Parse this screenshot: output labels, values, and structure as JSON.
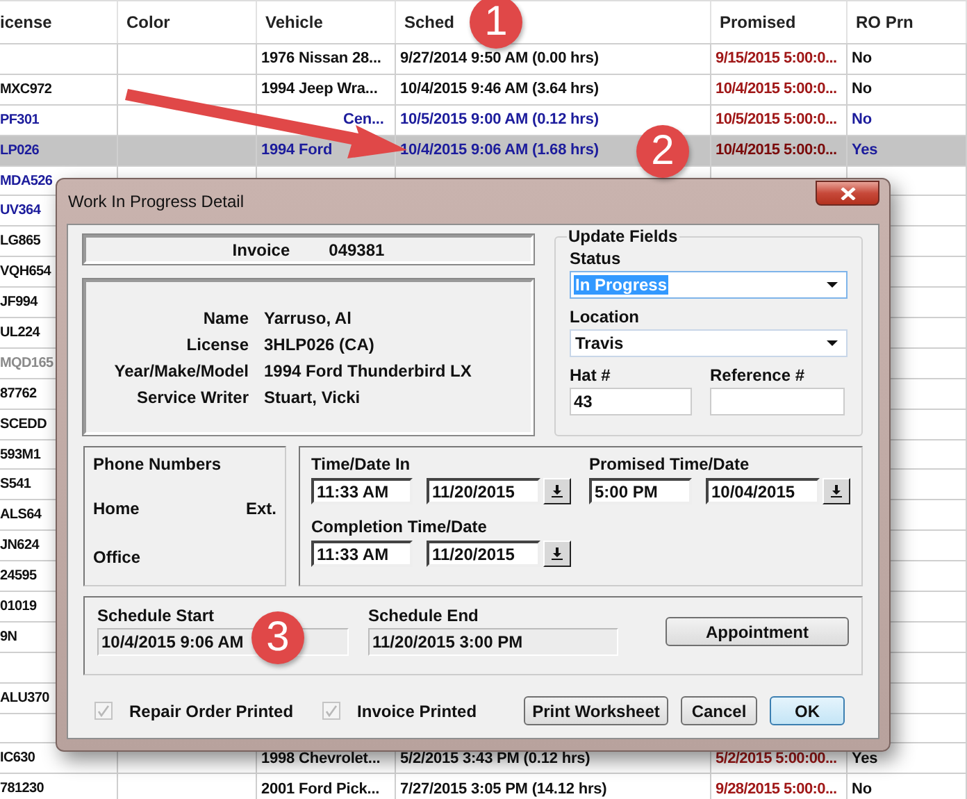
{
  "table": {
    "columns": [
      "icense",
      "Color",
      "Vehicle",
      "Sched",
      "Promised",
      "RO Prn"
    ],
    "rows": [
      {
        "vehicle": "1976 Nissan 28...",
        "sched": "9/27/2014 9:50 AM (0.00 hrs)",
        "promised": "9/15/2015 5:00:0...",
        "ro_prn": "No",
        "color": "#111111",
        "selected": false
      },
      {
        "license": "MXC972",
        "vehicle": "1994 Jeep Wra...",
        "sched": "10/4/2015 9:46 AM (3.64 hrs)",
        "promised": "10/4/2015 5:00:0...",
        "ro_prn": "No",
        "color": "#111111",
        "selected": false
      },
      {
        "license": "PF301",
        "vehicle": "Cen...",
        "sched": "10/5/2015 9:00 AM (0.12 hrs)",
        "promised": "10/5/2015 5:00:0...",
        "ro_prn": "No",
        "color": "#1c1c9c",
        "selected": false
      },
      {
        "license": "LP026",
        "vehicle": "1994 Ford",
        "sched": "10/4/2015 9:06 AM (1.68 hrs)",
        "promised": "10/4/2015 5:00:0...",
        "ro_prn": "Yes",
        "color": "#1c1c9c",
        "selected": true
      },
      {
        "license": "MDA526",
        "color": "#1c1c9c",
        "selected": false
      },
      {
        "license": "UV364",
        "color": "#1c1c9c",
        "selected": false
      },
      {
        "license": "LG865",
        "color": "#111111",
        "selected": false
      },
      {
        "license": "VQH654",
        "color": "#111111",
        "selected": false
      },
      {
        "license": "JF994",
        "color": "#111111",
        "selected": false
      },
      {
        "license": "UL224",
        "color": "#111111",
        "selected": false
      },
      {
        "license": "MQD165",
        "color": "#8a8a8a",
        "selected": false
      },
      {
        "license": "87762",
        "color": "#111111",
        "selected": false
      },
      {
        "license": "SCEDD",
        "color": "#111111",
        "selected": false
      },
      {
        "license": "593M1",
        "color": "#111111",
        "selected": false
      },
      {
        "license": "S541",
        "color": "#111111",
        "selected": false
      },
      {
        "license": "ALS64",
        "color": "#111111",
        "selected": false
      },
      {
        "license": "JN624",
        "color": "#111111",
        "selected": false
      },
      {
        "license": "24595",
        "color": "#111111",
        "selected": false
      },
      {
        "license": "01019",
        "color": "#111111",
        "selected": false
      },
      {
        "license": "9N",
        "color": "#111111",
        "selected": false
      },
      {
        "selected": false
      },
      {
        "license": "ALU370",
        "color": "#111111",
        "selected": false
      },
      {
        "selected": false
      },
      {
        "license": "IC630",
        "vehicle": "1998 Chevrolet...",
        "sched": "5/2/2015 3:43 PM (0.12 hrs)",
        "promised": "5/2/2015 5:00:00...",
        "ro_prn": "Yes",
        "color": "#111111",
        "selected": false
      },
      {
        "license": "781230",
        "vehicle": "2001 Ford Pick...",
        "sched": "7/27/2015 3:05 PM (14.12 hrs)",
        "promised": "9/28/2015 5:00:0...",
        "ro_prn": "No",
        "color": "#111111",
        "selected": false
      }
    ]
  },
  "dialog": {
    "title": "Work In Progress Detail",
    "invoice": {
      "label": "Invoice",
      "value": "049381"
    },
    "customer": [
      {
        "label": "Name",
        "value": "Yarruso, Al"
      },
      {
        "label": "License",
        "value": "3HLP026 (CA)"
      },
      {
        "label": "Year/Make/Model",
        "value": "1994 Ford Thunderbird LX"
      },
      {
        "label": "Service Writer",
        "value": "Stuart, Vicki"
      }
    ],
    "update_fields": {
      "title": "Update Fields",
      "status": {
        "label": "Status",
        "value": "In Progress",
        "focused": true
      },
      "location": {
        "label": "Location",
        "value": "Travis"
      },
      "hat": {
        "label": "Hat #",
        "value": "43"
      },
      "reference": {
        "label": "Reference #"
      }
    },
    "phone": {
      "title": "Phone Numbers",
      "home": "Home",
      "ext": "Ext.",
      "office": "Office"
    },
    "times": {
      "time_in": {
        "label": "Time/Date In",
        "time": "11:33 AM",
        "date": "11/20/2015"
      },
      "promised": {
        "label": "Promised Time/Date",
        "time": "5:00 PM",
        "date": "10/04/2015"
      },
      "completion": {
        "label": "Completion Time/Date",
        "time": "11:33 AM",
        "date": "11/20/2015"
      }
    },
    "schedule": {
      "start": {
        "label": "Schedule Start",
        "value": "10/4/2015 9:06 AM"
      },
      "end": {
        "label": "Schedule End",
        "value": "11/20/2015 3:00 PM"
      },
      "appointment": "Appointment"
    },
    "checkboxes": [
      {
        "label": "Repair Order Printed",
        "checked": true,
        "disabled": true
      },
      {
        "label": "Invoice Printed",
        "checked": true,
        "disabled": true
      }
    ],
    "buttons": [
      {
        "label": "Print Worksheet",
        "default": false
      },
      {
        "label": "Cancel",
        "default": false
      },
      {
        "label": "OK",
        "default": true
      }
    ]
  },
  "annotations": [
    {
      "label": "1"
    },
    {
      "label": "2"
    },
    {
      "label": "3"
    }
  ]
}
